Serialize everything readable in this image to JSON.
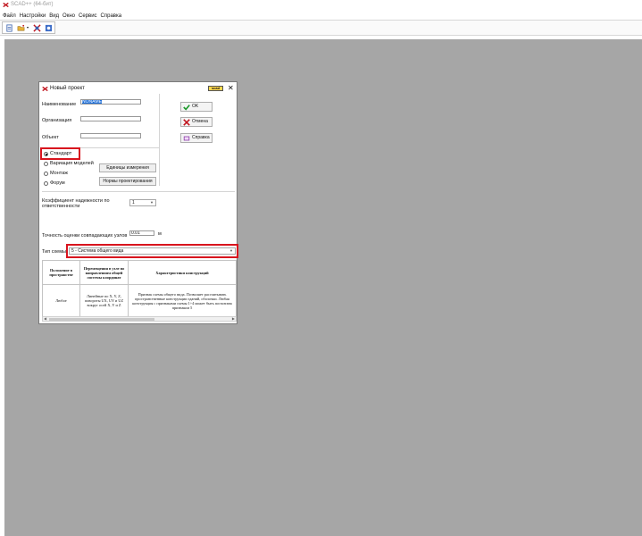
{
  "window": {
    "title": "SCAD++ (64-бит)"
  },
  "menu": [
    "Файл",
    "Настройки",
    "Вид",
    "Окно",
    "Сервис",
    "Справка"
  ],
  "toolbar": {
    "icons": [
      "new-icon",
      "open-icon",
      "tools-icon",
      "settings-icon"
    ]
  },
  "dialog": {
    "title": "Новый проект",
    "logo_text": "scad",
    "close": "✕",
    "name_label": "Наименование",
    "name_value": "NONAME",
    "org_label": "Организация",
    "org_value": "",
    "object_label": "Объект",
    "object_value": "",
    "ok_label": "OK",
    "cancel_label": "Отмена",
    "help_label": "Справка",
    "radio": [
      "Стандарт",
      "Вариация моделей",
      "Монтаж",
      "Форум"
    ],
    "radio_selected": "Стандарт",
    "units_button": "Единицы измерения",
    "norms_button": "Нормы проектирования",
    "reliability_label": "Коэффициент надежности по ответственности",
    "reliability_value": "1",
    "accuracy_label": "Точность оценки совпадающих узлов",
    "accuracy_value": "0.01",
    "accuracy_unit": "м",
    "scheme_label": "Тип схемы",
    "scheme_value": "5 - Система общего вида",
    "table": {
      "headers": [
        "Положение в пространстве",
        "Перемещения в узле по направлениям общей системы координат",
        "Характеристики конструкций"
      ],
      "rows": [
        [
          "Любое",
          "Линейные по X, Y, Z, повороты UX, UY и UZ вокруг осей X, Y и Z",
          "Признак схемы общего вида. Позволяет рассчитывать пространственные конструкции зданий, оболочки. Любая конструкция с признаками схемы 1÷4 может быть посчитана признаком 5"
        ]
      ]
    }
  },
  "colors": {
    "workspace": "#a6a6a6",
    "highlight": "#d8141e",
    "selection": "#1e6fd9"
  }
}
